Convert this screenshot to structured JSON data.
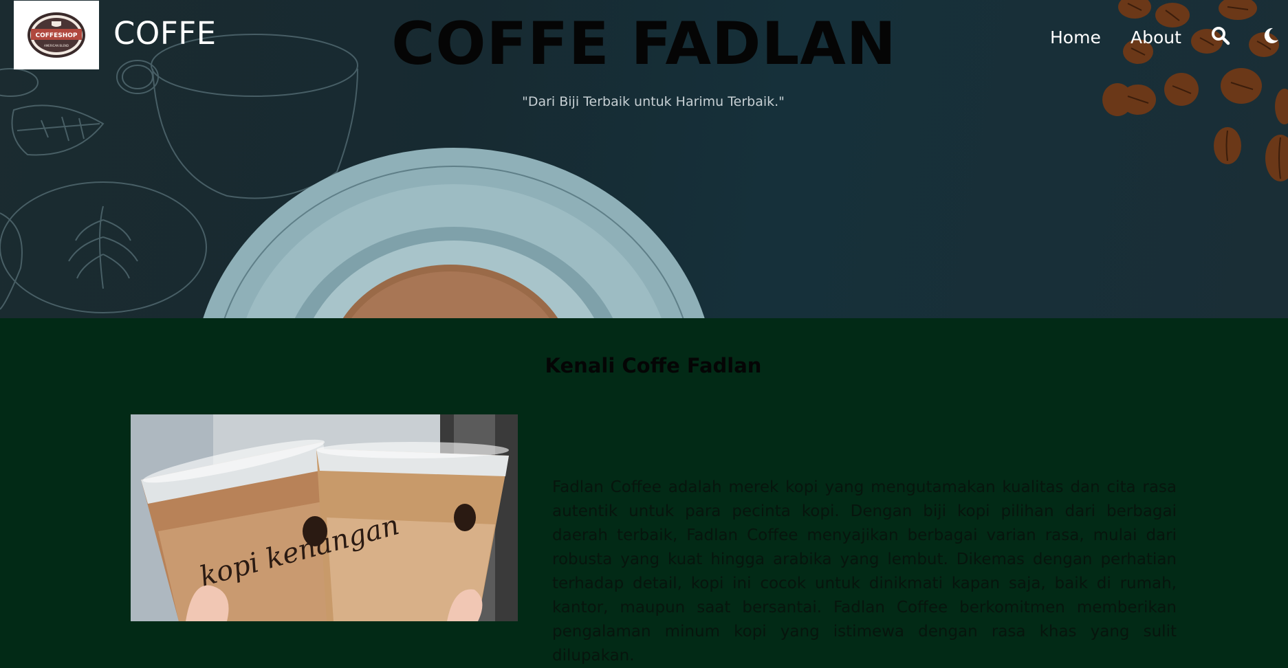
{
  "header": {
    "logo_text": "COFFESHOP",
    "logo_subtext": "AMERICAN BLEND",
    "brand": "COFFE",
    "nav": [
      {
        "label": "Home"
      },
      {
        "label": "About"
      }
    ],
    "icons": [
      "search-icon",
      "moon-icon"
    ]
  },
  "hero": {
    "title": "COFFE FADLAN",
    "tagline": "\"Dari Biji Terbaik untuk Harimu Terbaik.\""
  },
  "about": {
    "heading": "Kenali Coffe Fadlan",
    "paragraph": "Fadlan Coffee adalah merek kopi yang mengutamakan kualitas dan cita rasa autentik untuk para pecinta kopi. Dengan biji kopi pilihan dari berbagai daerah terbaik, Fadlan Coffee menyajikan berbagai varian rasa, mulai dari robusta yang kuat hingga arabika yang lembut. Dikemas dengan perhatian terhadap detail, kopi ini cocok untuk dinikmati kapan saja, baik di rumah, kantor, maupun saat bersantai. Fadlan Coffee berkomitmen memberikan pengalaman minum kopi yang istimewa dengan rasa khas yang sulit dilupakan.",
    "cup_text": "kopi kenangan"
  },
  "colors": {
    "hero_bg": "#1b2b30",
    "section_bg": "#022a16",
    "nav_text": "#ffffff"
  }
}
